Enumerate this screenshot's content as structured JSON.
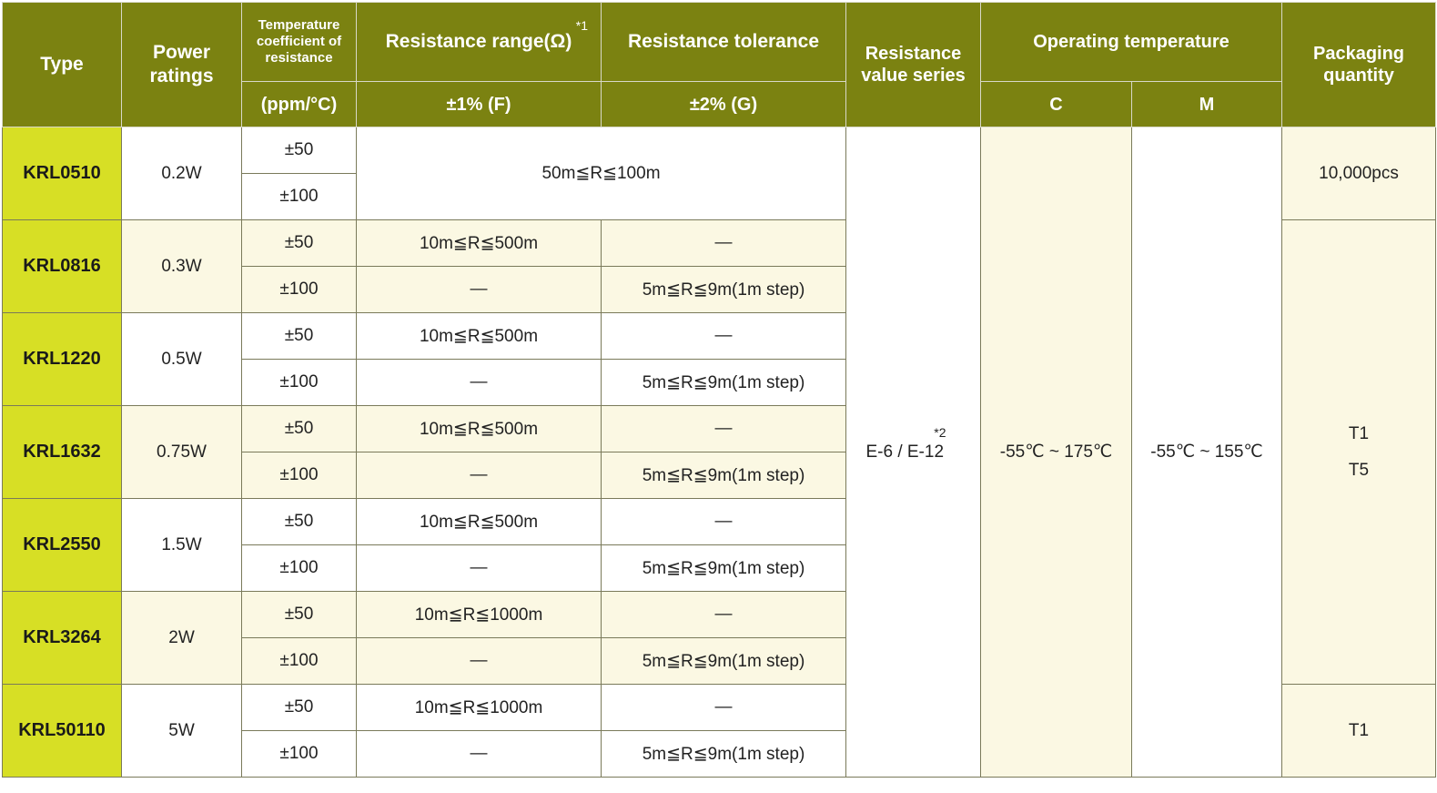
{
  "headers": {
    "type": "Type",
    "power": "Power ratings",
    "tcr": "Temperature coefficient of resistance",
    "tcr_unit": "(ppm/°C)",
    "res_range": "Resistance range(Ω)",
    "res_range_note": "*1",
    "res_tol": "Resistance tolerance",
    "tol_f": "±1% (F)",
    "tol_g": "±2% (G)",
    "series": "Resistance value series",
    "op_temp": "Operating temperature",
    "op_c": "C",
    "op_m": "M",
    "packaging": "Packaging quantity"
  },
  "series_value": "E-6 / E-12",
  "series_note": "*2",
  "op_c_value": "-55℃ ~ 175℃",
  "op_m_value": "-55℃ ~ 155℃",
  "packaging": {
    "krl0510": "10,000pcs",
    "group1_a": "T1",
    "group1_b": "T5",
    "group2": "T1"
  },
  "rows": [
    {
      "type": "KRL0510",
      "power": "0.2W",
      "tcr1": "±50",
      "tcr2": "±100",
      "merged": "50m≦R≦100m"
    },
    {
      "type": "KRL0816",
      "power": "0.3W",
      "tcr1": "±50",
      "f1": "10m≦R≦500m",
      "g1": "—",
      "tcr2": "±100",
      "f2": "—",
      "g2": "5m≦R≦9m(1m step)"
    },
    {
      "type": "KRL1220",
      "power": "0.5W",
      "tcr1": "±50",
      "f1": "10m≦R≦500m",
      "g1": "—",
      "tcr2": "±100",
      "f2": "—",
      "g2": "5m≦R≦9m(1m step)"
    },
    {
      "type": "KRL1632",
      "power": "0.75W",
      "tcr1": "±50",
      "f1": "10m≦R≦500m",
      "g1": "—",
      "tcr2": "±100",
      "f2": "—",
      "g2": "5m≦R≦9m(1m step)"
    },
    {
      "type": "KRL2550",
      "power": "1.5W",
      "tcr1": "±50",
      "f1": "10m≦R≦500m",
      "g1": "—",
      "tcr2": "±100",
      "f2": "—",
      "g2": "5m≦R≦9m(1m step)"
    },
    {
      "type": "KRL3264",
      "power": "2W",
      "tcr1": "±50",
      "f1": "10m≦R≦1000m",
      "g1": "—",
      "tcr2": "±100",
      "f2": "—",
      "g2": "5m≦R≦9m(1m step)"
    },
    {
      "type": "KRL50110",
      "power": "5W",
      "tcr1": "±50",
      "f1": "10m≦R≦1000m",
      "g1": "—",
      "tcr2": "±100",
      "f2": "—",
      "g2": "5m≦R≦9m(1m step)"
    }
  ]
}
